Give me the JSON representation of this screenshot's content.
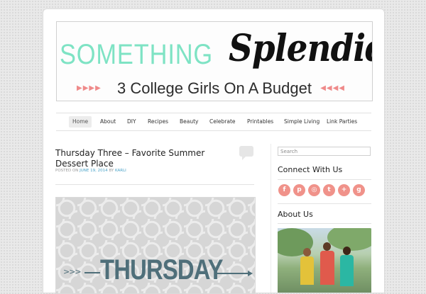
{
  "colors": {
    "brand_mint": "#7ee3c4",
    "accent_pink": "#f0928a",
    "link_blue": "#4aa3c8",
    "feature_teal": "#4f6f7a"
  },
  "header": {
    "brand_part1": "SOMETHING",
    "brand_part2": "Splendid",
    "tagline": "3 College Girls On A Budget",
    "arrows_left": "▶▶▶▶",
    "arrows_right": "◀◀◀◀"
  },
  "nav": {
    "items": [
      {
        "label": "Home",
        "active": true
      },
      {
        "label": "About"
      },
      {
        "label": "DIY"
      },
      {
        "label": "Recipes"
      },
      {
        "label": "Beauty"
      },
      {
        "label": "Celebrate"
      },
      {
        "label": "Printables"
      },
      {
        "label": "Simple Living"
      },
      {
        "label": "Link Parties"
      }
    ]
  },
  "post": {
    "title": "Thursday Three – Favorite Summer Dessert Place",
    "meta_prefix": "POSTED ON",
    "date": "JUNE 19, 2014",
    "meta_by": "BY",
    "author": "KARLI",
    "feature_word": "THURSDAY",
    "feature_arrow_icon": "arrow-right-icon"
  },
  "sidebar": {
    "search_placeholder": "Search",
    "connect_heading": "Connect With Us",
    "social": [
      {
        "icon": "facebook-icon",
        "glyph": "f"
      },
      {
        "icon": "pinterest-icon",
        "glyph": "p"
      },
      {
        "icon": "instagram-icon",
        "glyph": "◎"
      },
      {
        "icon": "twitter-icon",
        "glyph": "t"
      },
      {
        "icon": "google-plus-icon",
        "glyph": "+"
      },
      {
        "icon": "goodreads-icon",
        "glyph": "g"
      }
    ],
    "about_heading": "About Us"
  }
}
